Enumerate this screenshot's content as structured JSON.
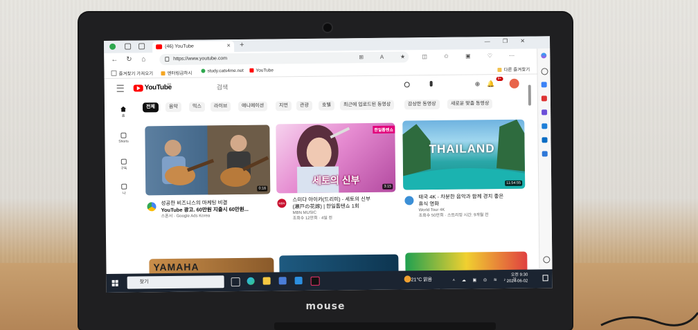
{
  "browser": {
    "tab_title": "(46) YouTube",
    "tab_close": "✕",
    "new_tab": "+",
    "url": "https://www.youtube.com",
    "bookmarks": [
      "즐겨찾기 가져오기",
      "엔터링급하시",
      "study.cats4me.net",
      "YouTube"
    ],
    "other_favorites": "다른 즐겨찾기",
    "window_controls": "— ❐ ✕",
    "right_icons": "⊞ A ★ ◫ ✩ ▣ ♡ ⋯"
  },
  "youtube": {
    "logo_text": "YouTube",
    "country_code": "KR",
    "search_placeholder": "검색",
    "notification_count": "9+",
    "chips": [
      "전체",
      "음악",
      "믹스",
      "라이브",
      "애니메이션",
      "지언",
      "관광",
      "호텔",
      "최근에 업로드된 동영상",
      "감상한 동영상",
      "새로운 맞춤 동영상"
    ],
    "left_nav": [
      "홈",
      "Shorts",
      "구독",
      "나"
    ],
    "videos": [
      {
        "title": "성공한 비즈니스의 마케팅 비결",
        "title2": "YouTube 광고. 60만원 지출시 60만원...",
        "channel": "스폰서 · Google Ads Korea",
        "meta": "",
        "duration": "0:16"
      },
      {
        "title": "스미다 아이카(드리미) - 세토의 신부",
        "title2": "(瀬戸の花嫁) | 한일톱텐쇼 1회",
        "channel": "MBN MUSIC",
        "meta": "조회수 12만회 · 4일 전",
        "duration": "3:15",
        "overlay": "세토의 신부",
        "tag": "한일톱텐쇼",
        "badge": "MBN"
      },
      {
        "title": "태국 4K - 차분한 음악과 함께 경치 좋은",
        "title2": "휴식 영화",
        "channel": "World Tour 4K",
        "meta": "조회수 50만회 · 스트리밍 시간: 9개월 전",
        "duration": "11:54:55",
        "overlay": "THAILAND"
      }
    ],
    "row2_overlay": "YAMAHA"
  },
  "taskbar": {
    "search_label": "찾기",
    "weather": "21°C 맑음",
    "time": "오전 9:30",
    "date": "2024-06-02"
  },
  "device": {
    "brand": "mouse"
  },
  "colors": {
    "youtube_red": "#ff0000",
    "taskbar": "#1b2431",
    "bezel": "#1f1f21"
  }
}
